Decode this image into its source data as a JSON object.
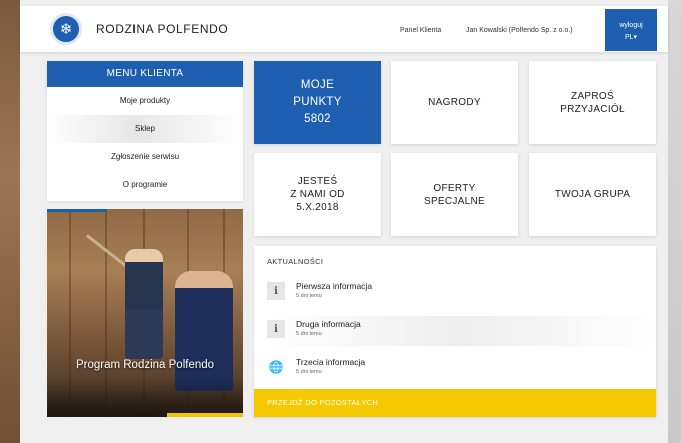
{
  "header": {
    "logo_icon": "snowflake-icon",
    "brand_prefix": "RODZ",
    "brand_bold": "I",
    "brand_suffix": "NA POLFENDO",
    "panel_link": "Panel Klienta",
    "user_name": "Jan Kowalski (Polfendo Sp. z o.o.)",
    "logout_label": "wyloguj",
    "language": "PL",
    "language_caret": "▾"
  },
  "menu": {
    "title": "MENU KLIENTA",
    "items": [
      {
        "label": "Moje produkty"
      },
      {
        "label": "Sklep"
      },
      {
        "label": "Zgłoszenie serwisu"
      },
      {
        "label": "O programie"
      }
    ]
  },
  "promo": {
    "caption": "Program Rodzina Polfendo"
  },
  "tiles": [
    {
      "label": "MOJE\nPUNKTY\n5802"
    },
    {
      "label": "NAGRODY"
    },
    {
      "label": "ZAPROŚ\nPRZYJACIÓŁ"
    },
    {
      "label": "JESTEŚ\nZ NAMI OD\n5.X.2018"
    },
    {
      "label": "OFERTY\nSPECJALNE"
    },
    {
      "label": "TWOJA GRUPA"
    }
  ],
  "news": {
    "title": "AKTUALNOŚCI",
    "items": [
      {
        "icon": "info-icon",
        "glyph": "i",
        "title": "Pierwsza informacja",
        "time": "5 dni temu"
      },
      {
        "icon": "info-icon",
        "glyph": "i",
        "title": "Druga informacja",
        "time": "5 dni temu"
      },
      {
        "icon": "globe-icon",
        "glyph": "🌐",
        "title": "Trzecia informacja",
        "time": "5 dni temu"
      }
    ],
    "more_label": "PRZEJDŹ DO POZOSTAŁYCH"
  },
  "colors": {
    "brand_blue": "#1f5fb1",
    "accent_yellow": "#f5c800",
    "background": "#efefef"
  }
}
